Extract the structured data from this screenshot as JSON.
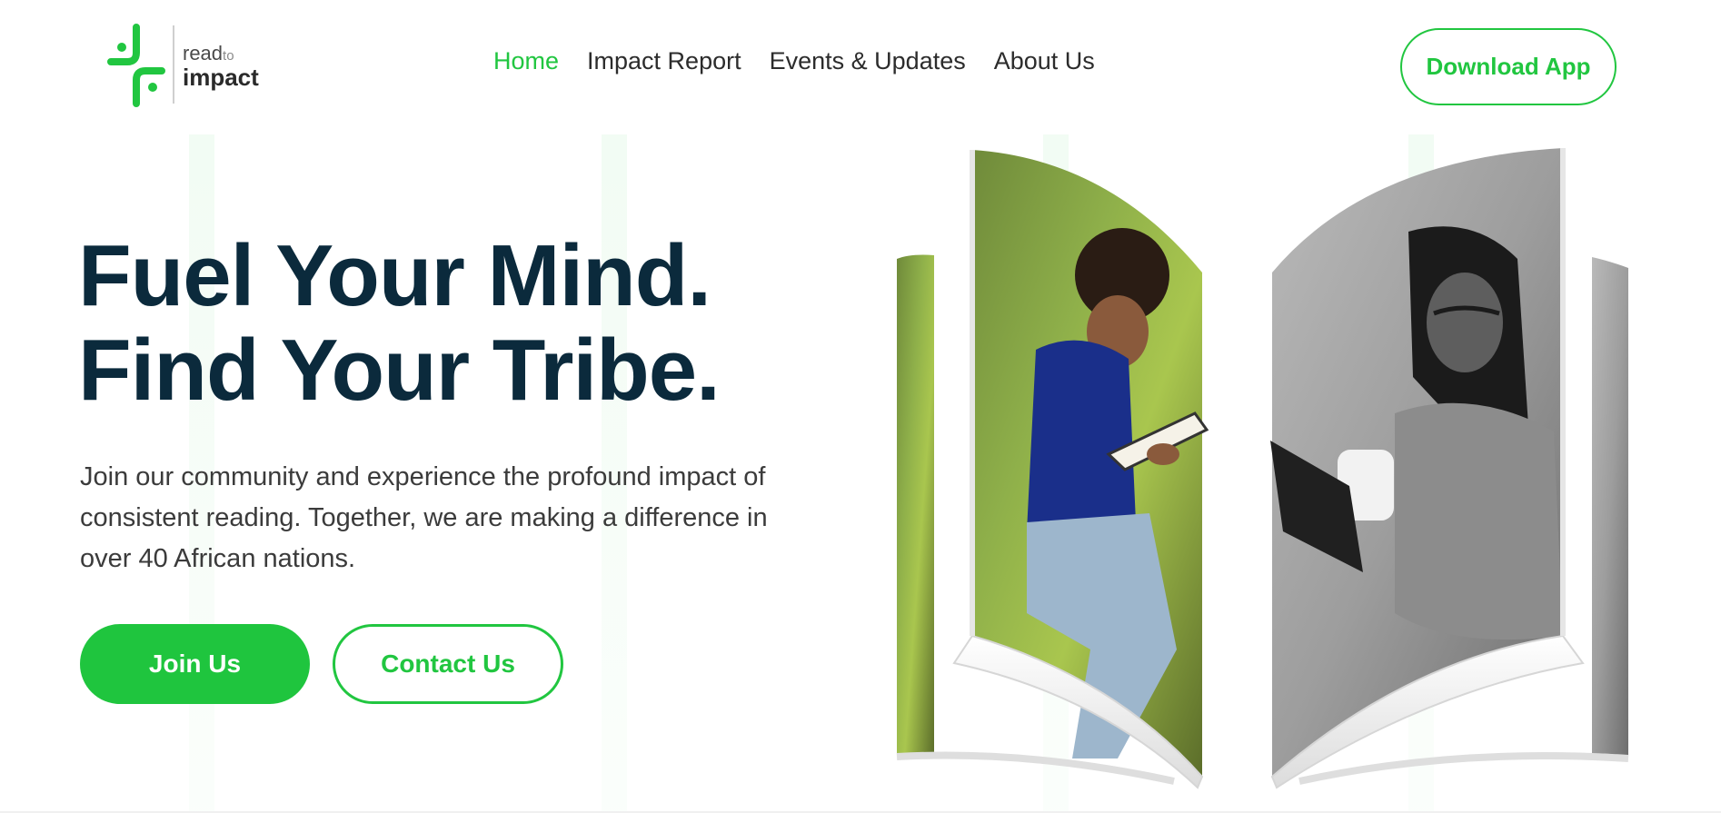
{
  "brand": {
    "logo_read": "read",
    "logo_to": "to",
    "logo_impact": "impact",
    "accent_color": "#21c640",
    "headline_color": "#0b2a3c"
  },
  "nav": {
    "items": [
      {
        "label": "Home",
        "active": true
      },
      {
        "label": "Impact Report",
        "active": false
      },
      {
        "label": "Events & Updates",
        "active": false
      },
      {
        "label": "About Us",
        "active": false
      }
    ],
    "download_label": "Download App"
  },
  "hero": {
    "headline_line1": "Fuel Your Mind.",
    "headline_line2": "Find Your Tribe.",
    "subtext": "Join our community and experience the profound impact of consistent reading. Together, we are making a difference in over 40 African nations.",
    "join_label": "Join Us",
    "contact_label": "Contact Us"
  },
  "illustration": {
    "icon": "open-book-photo-collage",
    "left_photo": "man reading a book outdoors",
    "right_photo": "woman reading a book holding a mug"
  }
}
